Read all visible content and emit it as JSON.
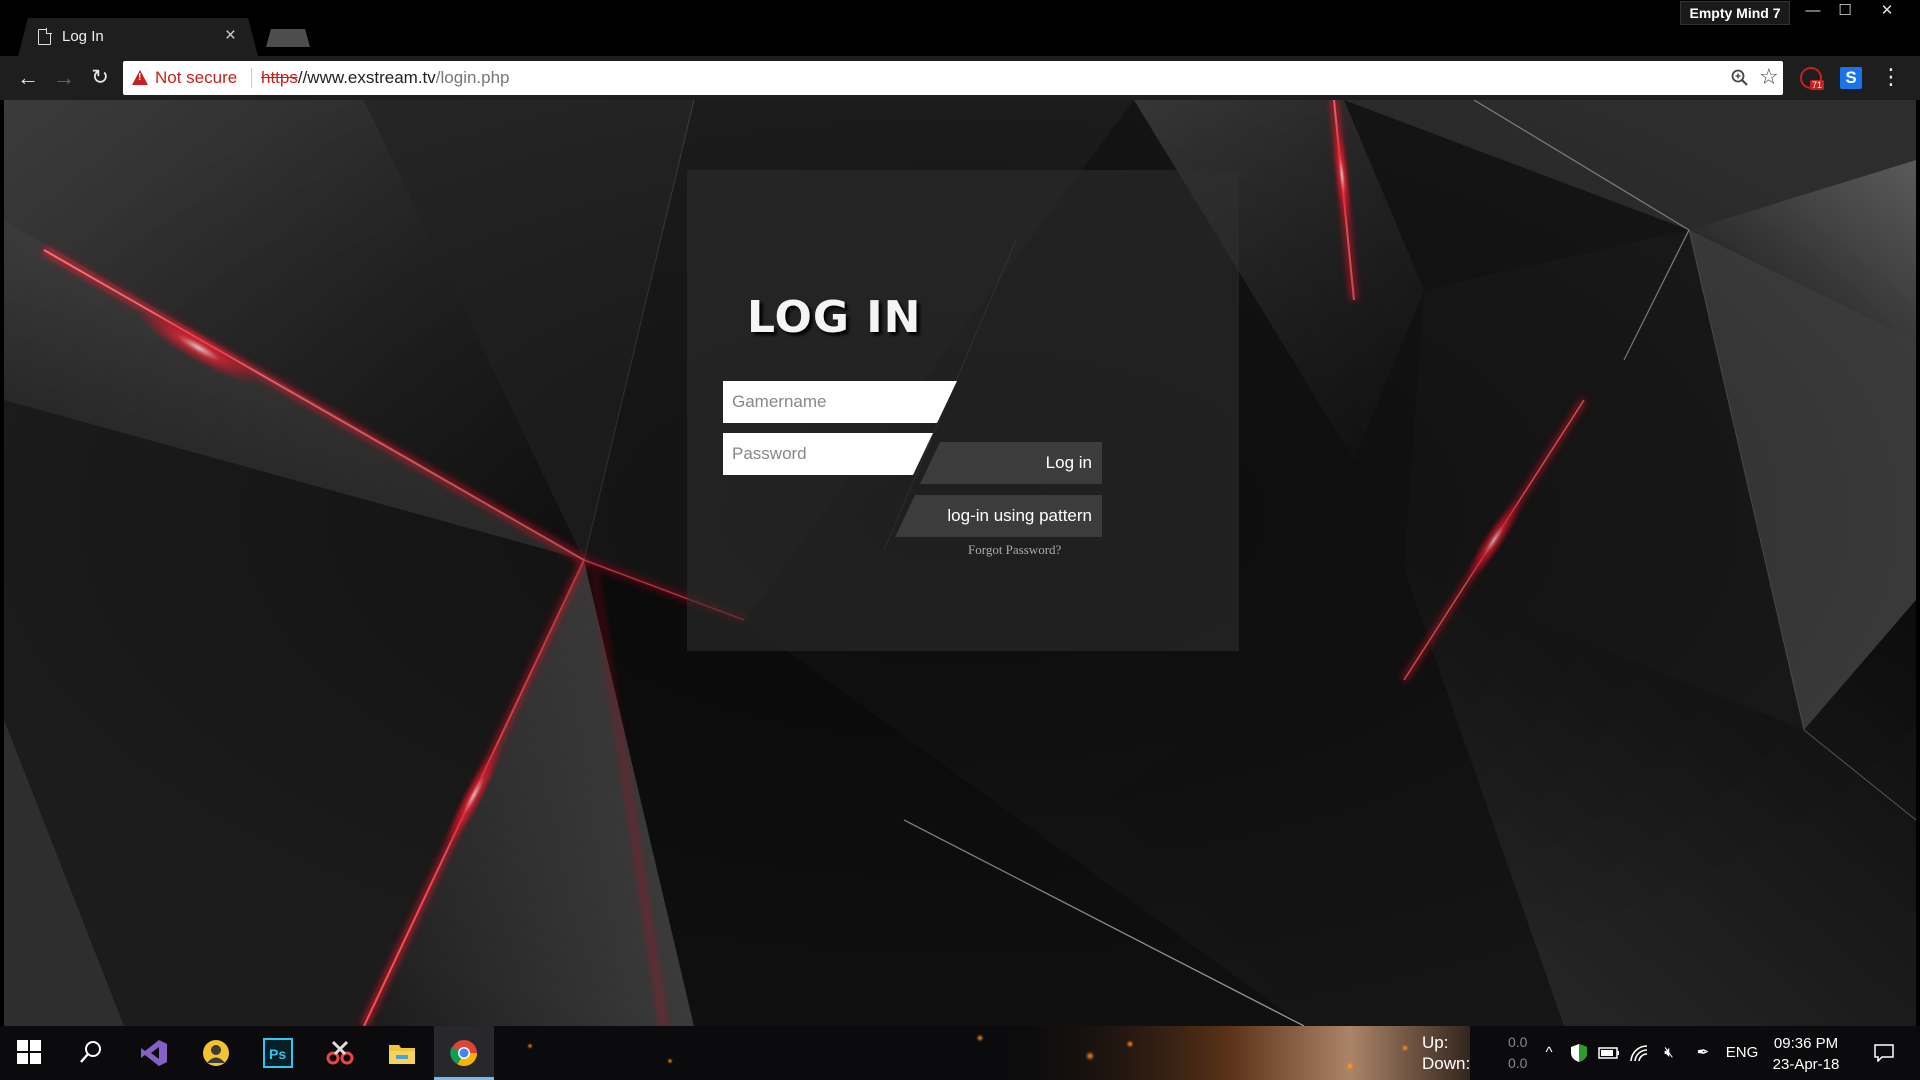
{
  "browser": {
    "tab_title": "Log In",
    "tab_close": "×",
    "profile_name": "Empty Mind 7",
    "window_controls": {
      "minimize": "—",
      "maximize": "☐",
      "close": "✕"
    },
    "nav": {
      "back": "←",
      "forward": "→",
      "reload": "↻",
      "menu": "⋮"
    },
    "security_label": "Not secure",
    "url_scheme": "https",
    "url_host": "//www.exstream.tv",
    "url_path": "/login.php",
    "extension_badge": "71",
    "extension2_letter": "S",
    "icons": [
      "page-icon",
      "warning-icon",
      "zoom-icon",
      "bookmark-star-icon",
      "extension-icon",
      "menu-icon"
    ]
  },
  "login": {
    "heading": "LOG IN",
    "gamername_placeholder": "Gamername",
    "password_placeholder": "Password",
    "login_button": "Log in",
    "pattern_button": "log-in using pattern",
    "forgot_link": "Forgot Password?"
  },
  "taskbar": {
    "apps": [
      "start-icon",
      "search-icon",
      "visual-studio-icon",
      "user-app-icon",
      "photoshop-icon",
      "sniper-tool-icon",
      "file-explorer-icon",
      "chrome-icon"
    ],
    "photoshop_label": "Ps",
    "net_up_label": "Up:",
    "net_down_label": "Down:",
    "net_up_value": "0.0",
    "net_down_value": "0.0",
    "tray": {
      "chevron": "^",
      "language": "ENG"
    },
    "time": "09:36 PM",
    "date": "23-Apr-18"
  },
  "colors": {
    "accent_red": "#ff1a2d",
    "chrome_bg": "#1e1e1e",
    "button_bg": "#3c3c3c",
    "insecure_red": "#c5221f"
  }
}
